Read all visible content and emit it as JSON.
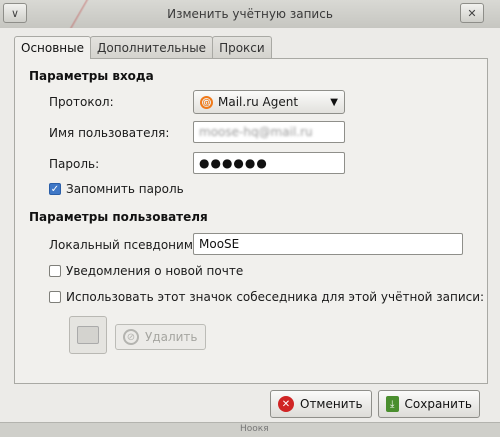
{
  "window": {
    "title": "Изменить учётную запись"
  },
  "titlebar": {
    "menu_glyph": "∨",
    "close_glyph": "✕"
  },
  "tabs": [
    {
      "label": "Основные"
    },
    {
      "label": "Дополнительные"
    },
    {
      "label": "Прокси"
    }
  ],
  "login": {
    "section_title": "Параметры входа",
    "protocol_label": "Протокол:",
    "protocol_value": "Mail.ru Agent",
    "username_label": "Имя пользователя:",
    "username_value": "moose-hq@mail.ru",
    "password_label": "Пароль:",
    "password_value": "●●●●●●",
    "remember_label": "Запомнить пароль",
    "remember_checked": true
  },
  "user": {
    "section_title": "Параметры пользователя",
    "alias_label": "Локальный псевдоним:",
    "alias_value": "MooSE",
    "notify_label": "Уведомления о новой почте",
    "notify_checked": false,
    "buddy_icon_label": "Использовать этот значок собеседника для этой учётной записи:",
    "buddy_icon_checked": false,
    "delete_label": "Удалить"
  },
  "footer": {
    "cancel_label": "Отменить",
    "save_label": "Сохранить"
  },
  "status_bar": {
    "text": "Ноокя"
  },
  "colors": {
    "accent": "#3f77c6",
    "cancel": "#d02424",
    "save": "#4a8e2e",
    "mail_ru": "#f07a1a"
  },
  "icons": [
    "chevron-down-icon",
    "close-icon",
    "mail-ru-icon",
    "cancel-icon",
    "save-icon",
    "delete-icon",
    "image-placeholder-icon"
  ]
}
